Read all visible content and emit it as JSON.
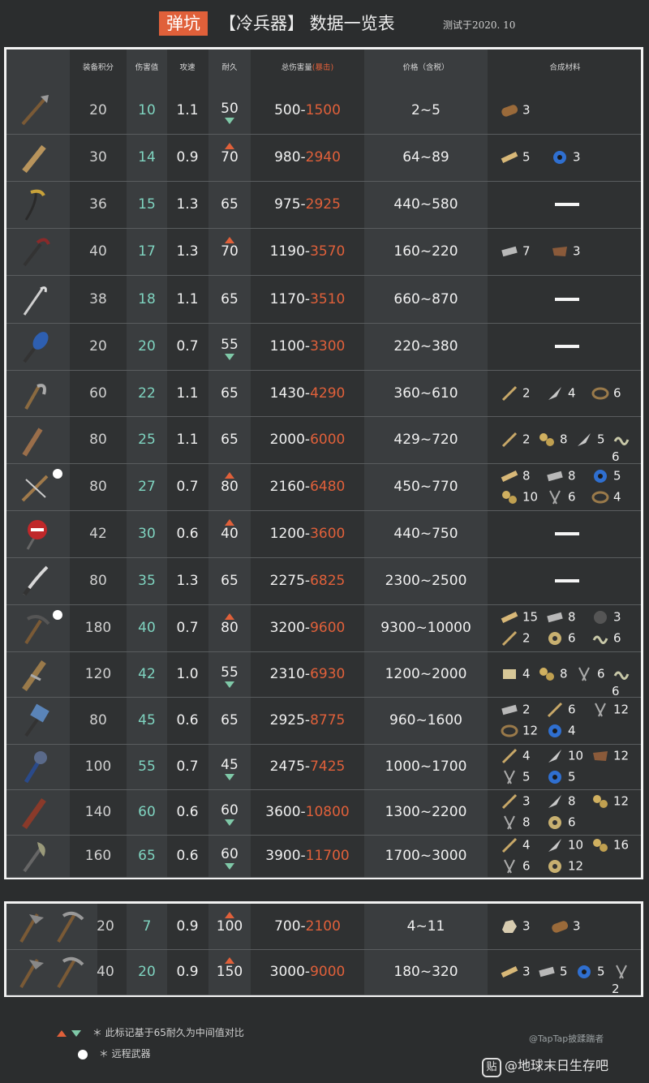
{
  "title": {
    "tag": "弹坑",
    "main": "【冷兵器】 数据一览表",
    "date": "测试于2020. 10"
  },
  "headers": {
    "score": "装备积分",
    "dmg": "伤害值",
    "spd": "攻速",
    "dur": "耐久",
    "total": "总伤害量",
    "crit": "(暴击)",
    "price": "价格（含税）",
    "mats": "合成材料"
  },
  "rows": [
    {
      "score": "20",
      "dmg": "10",
      "spd": "1.1",
      "dur": "50",
      "arrow": "down",
      "lo": "500-",
      "hi": "1500",
      "price": "2~5",
      "mats": [
        {
          "i": "log",
          "n": "3"
        }
      ],
      "ranged": false
    },
    {
      "score": "30",
      "dmg": "14",
      "spd": "0.9",
      "dur": "70",
      "arrow": "up",
      "lo": "980-",
      "hi": "2940",
      "price": "64~89",
      "mats": [
        {
          "i": "plank",
          "n": "5"
        },
        {
          "i": "tape",
          "n": "3"
        }
      ],
      "ranged": false
    },
    {
      "score": "36",
      "dmg": "15",
      "spd": "1.3",
      "dur": "65",
      "arrow": "",
      "lo": "975-",
      "hi": "2925",
      "price": "440~580",
      "mats": [],
      "ranged": false
    },
    {
      "score": "40",
      "dmg": "17",
      "spd": "1.3",
      "dur": "70",
      "arrow": "up",
      "lo": "1190-",
      "hi": "3570",
      "price": "160~220",
      "mats": [
        {
          "i": "ingot",
          "n": "7"
        },
        {
          "i": "leather",
          "n": "3"
        }
      ],
      "ranged": false
    },
    {
      "score": "38",
      "dmg": "18",
      "spd": "1.1",
      "dur": "65",
      "arrow": "",
      "lo": "1170-",
      "hi": "3510",
      "price": "660~870",
      "mats": [],
      "ranged": false
    },
    {
      "score": "20",
      "dmg": "20",
      "spd": "0.7",
      "dur": "55",
      "arrow": "down",
      "lo": "1100-",
      "hi": "3300",
      "price": "220~380",
      "mats": [],
      "ranged": false
    },
    {
      "score": "60",
      "dmg": "22",
      "spd": "1.1",
      "dur": "65",
      "arrow": "",
      "lo": "1430-",
      "hi": "4290",
      "price": "360~610",
      "mats": [
        {
          "i": "stick",
          "n": "2"
        },
        {
          "i": "blade",
          "n": "4"
        },
        {
          "i": "rope",
          "n": "6"
        }
      ],
      "ranged": false
    },
    {
      "score": "80",
      "dmg": "25",
      "spd": "1.1",
      "dur": "65",
      "arrow": "",
      "lo": "2000-",
      "hi": "6000",
      "price": "429~720",
      "mats": [
        {
          "i": "stick",
          "n": "2"
        },
        {
          "i": "parts",
          "n": "8"
        },
        {
          "i": "blade",
          "n": "5"
        },
        {
          "i": "spring",
          "n": "6"
        }
      ],
      "ranged": false
    },
    {
      "score": "80",
      "dmg": "27",
      "spd": "0.7",
      "dur": "80",
      "arrow": "up",
      "lo": "2160-",
      "hi": "6480",
      "price": "450~770",
      "mats": [
        {
          "i": "plank",
          "n": "8"
        },
        {
          "i": "ingot",
          "n": "8"
        },
        {
          "i": "tape",
          "n": "5"
        },
        {
          "i": "parts",
          "n": "10"
        },
        {
          "i": "nails",
          "n": "6"
        },
        {
          "i": "rope",
          "n": "4"
        }
      ],
      "ranged": true
    },
    {
      "score": "42",
      "dmg": "30",
      "spd": "0.6",
      "dur": "40",
      "arrow": "up",
      "lo": "1200-",
      "hi": "3600",
      "price": "440~750",
      "mats": [],
      "ranged": false
    },
    {
      "score": "80",
      "dmg": "35",
      "spd": "1.3",
      "dur": "65",
      "arrow": "",
      "lo": "2275-",
      "hi": "6825",
      "price": "2300~2500",
      "mats": [],
      "ranged": false
    },
    {
      "score": "180",
      "dmg": "40",
      "spd": "0.7",
      "dur": "80",
      "arrow": "up",
      "lo": "3200-",
      "hi": "9600",
      "price": "9300~10000",
      "mats": [
        {
          "i": "plank",
          "n": "15"
        },
        {
          "i": "ingot",
          "n": "8"
        },
        {
          "i": "ball",
          "n": "3"
        },
        {
          "i": "stick",
          "n": "2"
        },
        {
          "i": "gear",
          "n": "6"
        },
        {
          "i": "spring",
          "n": "6"
        }
      ],
      "ranged": true
    },
    {
      "score": "120",
      "dmg": "42",
      "spd": "1.0",
      "dur": "55",
      "arrow": "down",
      "lo": "2310-",
      "hi": "6930",
      "price": "1200~2000",
      "mats": [
        {
          "i": "block",
          "n": "4"
        },
        {
          "i": "parts",
          "n": "8"
        },
        {
          "i": "nails",
          "n": "6"
        },
        {
          "i": "spring",
          "n": "6"
        }
      ],
      "ranged": false
    },
    {
      "score": "80",
      "dmg": "45",
      "spd": "0.6",
      "dur": "65",
      "arrow": "",
      "lo": "2925-",
      "hi": "8775",
      "price": "960~1600",
      "mats": [
        {
          "i": "ingot",
          "n": "2"
        },
        {
          "i": "stick",
          "n": "6"
        },
        {
          "i": "nails",
          "n": "12"
        },
        {
          "i": "rope",
          "n": "12"
        },
        {
          "i": "tape",
          "n": "4"
        }
      ],
      "ranged": false
    },
    {
      "score": "100",
      "dmg": "55",
      "spd": "0.7",
      "dur": "45",
      "arrow": "down",
      "lo": "2475-",
      "hi": "7425",
      "price": "1000~1700",
      "mats": [
        {
          "i": "stick",
          "n": "4"
        },
        {
          "i": "blade",
          "n": "10"
        },
        {
          "i": "leather",
          "n": "12"
        },
        {
          "i": "nails",
          "n": "5"
        },
        {
          "i": "tape",
          "n": "5"
        }
      ],
      "ranged": false
    },
    {
      "score": "140",
      "dmg": "60",
      "spd": "0.6",
      "dur": "60",
      "arrow": "down",
      "lo": "3600-",
      "hi": "10800",
      "price": "1300~2200",
      "mats": [
        {
          "i": "stick",
          "n": "3"
        },
        {
          "i": "blade",
          "n": "8"
        },
        {
          "i": "parts",
          "n": "12"
        },
        {
          "i": "nails",
          "n": "8"
        },
        {
          "i": "gear",
          "n": "6"
        }
      ],
      "ranged": false
    },
    {
      "score": "160",
      "dmg": "65",
      "spd": "0.6",
      "dur": "60",
      "arrow": "down",
      "lo": "3900-",
      "hi": "11700",
      "price": "1700~3000",
      "mats": [
        {
          "i": "stick",
          "n": "4"
        },
        {
          "i": "blade",
          "n": "10"
        },
        {
          "i": "parts",
          "n": "16"
        },
        {
          "i": "nails",
          "n": "6"
        },
        {
          "i": "gear",
          "n": "12"
        }
      ],
      "ranged": false
    }
  ],
  "tools": [
    {
      "score": "20",
      "dmg": "7",
      "spd": "0.9",
      "dur": "100",
      "arrow": "up",
      "lo": "700-",
      "hi": "2100",
      "price": "4~11",
      "mats": [
        {
          "i": "rock",
          "n": "3"
        },
        {
          "i": "log",
          "n": "3"
        }
      ]
    },
    {
      "score": "40",
      "dmg": "20",
      "spd": "0.9",
      "dur": "150",
      "arrow": "up",
      "lo": "3000-",
      "hi": "9000",
      "price": "180~320",
      "mats": [
        {
          "i": "plank",
          "n": "3"
        },
        {
          "i": "ingot",
          "n": "5"
        },
        {
          "i": "tape",
          "n": "5"
        },
        {
          "i": "nails",
          "n": "2"
        }
      ]
    }
  ],
  "legend": {
    "arrows_text": "＊ 此标记基于65耐久为中间值对比",
    "dot_text": "＊ 远程武器"
  },
  "credit": "@TapTap披蹂踹者",
  "watermark": {
    "badge": "贴",
    "text": "@地球末日生存吧"
  },
  "colors": {
    "accent": "#e0603a",
    "teal": "#7fd4c0",
    "down": "#7fc9a8"
  }
}
